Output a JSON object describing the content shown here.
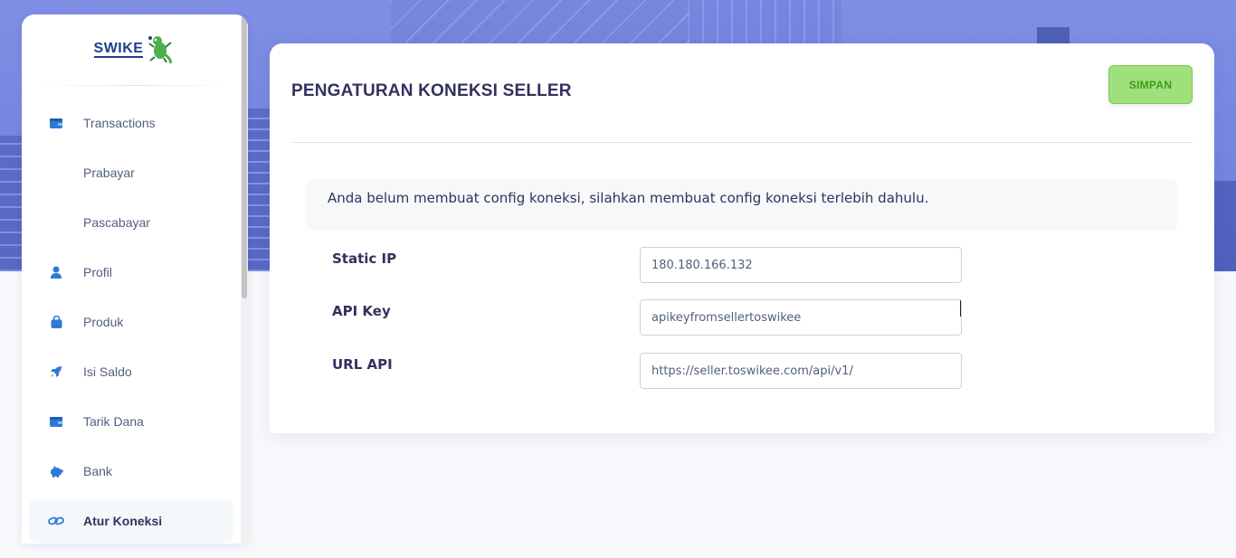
{
  "brand": {
    "name": "SWIKE"
  },
  "sidebar": {
    "items": [
      {
        "label": "Transactions",
        "icon": "wallet-icon"
      },
      {
        "label": "Prabayar",
        "icon": ""
      },
      {
        "label": "Pascabayar",
        "icon": ""
      },
      {
        "label": "Profil",
        "icon": "user-icon"
      },
      {
        "label": "Produk",
        "icon": "shopping-bag-icon"
      },
      {
        "label": "Isi Saldo",
        "icon": "rocket-icon"
      },
      {
        "label": "Tarik Dana",
        "icon": "wallet-icon"
      },
      {
        "label": "Bank",
        "icon": "piggy-bank-icon"
      },
      {
        "label": "Atur Koneksi",
        "icon": "link-icon",
        "active": true
      }
    ]
  },
  "page": {
    "title": "PENGATURAN KONEKSI SELLER",
    "save_label": "SIMPAN",
    "notice": "Anda belum membuat config koneksi, silahkan membuat config koneksi terlebih dahulu."
  },
  "form": {
    "static_ip": {
      "label": "Static IP",
      "value": "180.180.166.132"
    },
    "api_key": {
      "label": "API Key",
      "value": "apikeyfromsellertoswikee"
    },
    "url_api": {
      "label": "URL API",
      "value": "https://seller.toswikee.com/api/v1/"
    }
  },
  "colors": {
    "accent_icon": "#2d7ad6",
    "save_button_bg": "#9ee07b",
    "save_button_text": "#3f9a1c",
    "hero_bg": "#7f8fe4"
  }
}
